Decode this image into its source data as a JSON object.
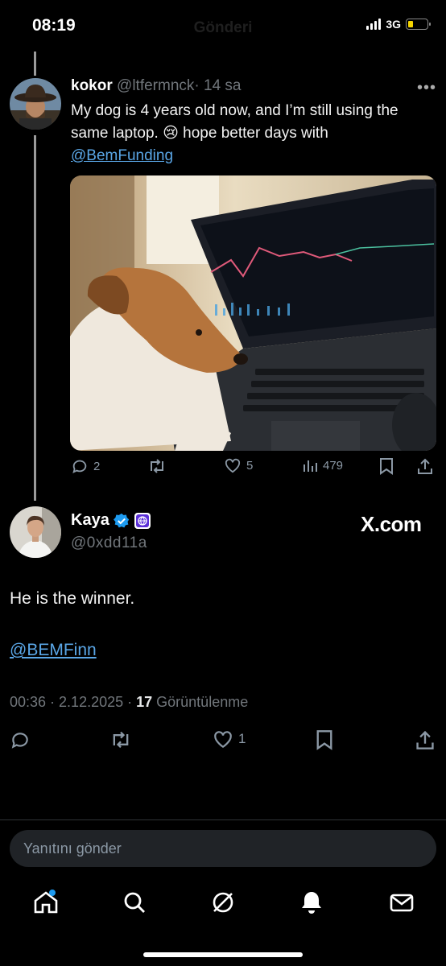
{
  "status_bar": {
    "time": "08:19",
    "title": "Gönderi",
    "network": "3G",
    "battery_level": 0.25
  },
  "parent_tweet": {
    "name": "kokor",
    "handle": "@ltfermnck",
    "time_sep": "·",
    "time_ago": "14 sa",
    "more": "•••",
    "text": "My dog is 4 years old now, and I’m still using the same laptop. 😢 hope better days with",
    "mention": "@BemFunding",
    "replies": "2",
    "likes": "5",
    "views": "479"
  },
  "main_tweet": {
    "name": "Kaya",
    "handle": "@0xdd11a",
    "brand": "X.com",
    "body": "He is the winner.",
    "mention": "@BEMFinn",
    "timestamp": "00:36 · 2.12.2025 · ",
    "views_count": "17",
    "views_label": " Görüntülenme",
    "likes": "1"
  },
  "reply_box": {
    "placeholder": "Yanıtını gönder"
  },
  "colors": {
    "background": "#000000",
    "link": "#5aa6e6",
    "verified": "#1d9bf0",
    "notification_dot": "#1d9bf0",
    "battery": "#f5d400"
  }
}
